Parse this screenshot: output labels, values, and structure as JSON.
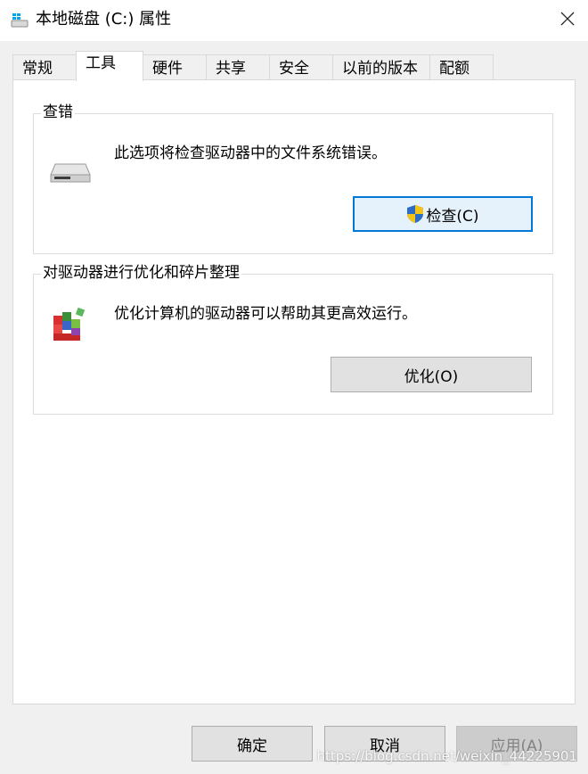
{
  "window": {
    "title": "本地磁盘 (C:) 属性"
  },
  "tabs": [
    {
      "label": "常规"
    },
    {
      "label": "工具"
    },
    {
      "label": "硬件"
    },
    {
      "label": "共享"
    },
    {
      "label": "安全"
    },
    {
      "label": "以前的版本"
    },
    {
      "label": "配额"
    }
  ],
  "active_tab": "工具",
  "check": {
    "title": "查错",
    "description": "此选项将检查驱动器中的文件系统错误。",
    "button": "检查(C)"
  },
  "optimize": {
    "title": "对驱动器进行优化和碎片整理",
    "description": "优化计算机的驱动器可以帮助其更高效运行。",
    "button": "优化(O)"
  },
  "footer": {
    "ok": "确定",
    "cancel": "取消",
    "apply": "应用(A)"
  },
  "watermark": "https://blog.csdn.net/weixin_44225901",
  "colors": {
    "accent": "#0078d7"
  },
  "icons": [
    "windows-drive-icon",
    "close-icon",
    "hard-drive-icon",
    "uac-shield-icon",
    "defrag-icon"
  ]
}
